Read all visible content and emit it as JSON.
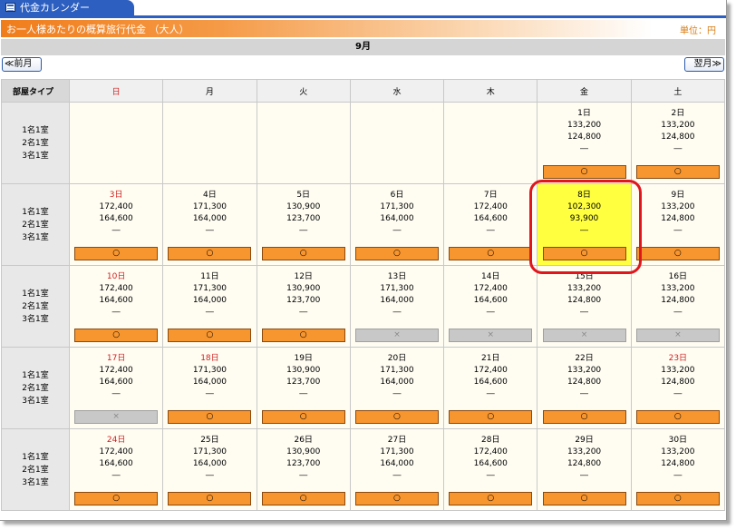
{
  "window": {
    "tab_title": "代金カレンダー"
  },
  "banner": {
    "title": "お一人様あたりの概算旅行代金 （大人）",
    "unit": "単位：円"
  },
  "month": "9月",
  "nav": {
    "prev": "≪前月",
    "next": "翌月≫"
  },
  "header": {
    "room_type": "部屋タイプ",
    "weekdays": [
      "日",
      "月",
      "火",
      "水",
      "木",
      "金",
      "土"
    ]
  },
  "room_types": [
    "1名1室",
    "2名1室",
    "3名1室"
  ],
  "weeks": [
    [
      null,
      null,
      null,
      null,
      null,
      {
        "date": "1日",
        "prices": [
          "133,200",
          "124,800",
          "―"
        ],
        "mark": "○"
      },
      {
        "date": "2日",
        "prices": [
          "133,200",
          "124,800",
          "―"
        ],
        "mark": "○"
      }
    ],
    [
      {
        "date": "3日",
        "prices": [
          "172,400",
          "164,600",
          "―"
        ],
        "mark": "○"
      },
      {
        "date": "4日",
        "prices": [
          "171,300",
          "164,000",
          "―"
        ],
        "mark": "○"
      },
      {
        "date": "5日",
        "prices": [
          "130,900",
          "123,700",
          "―"
        ],
        "mark": "○"
      },
      {
        "date": "6日",
        "prices": [
          "171,300",
          "164,000",
          "―"
        ],
        "mark": "○"
      },
      {
        "date": "7日",
        "prices": [
          "172,400",
          "164,600",
          "―"
        ],
        "mark": "○"
      },
      {
        "date": "8日",
        "prices": [
          "102,300",
          "93,900",
          "―"
        ],
        "mark": "○",
        "highlight": true
      },
      {
        "date": "9日",
        "prices": [
          "133,200",
          "124,800",
          "―"
        ],
        "mark": "○"
      }
    ],
    [
      {
        "date": "10日",
        "prices": [
          "172,400",
          "164,600",
          "―"
        ],
        "mark": "○"
      },
      {
        "date": "11日",
        "prices": [
          "171,300",
          "164,000",
          "―"
        ],
        "mark": "○"
      },
      {
        "date": "12日",
        "prices": [
          "130,900",
          "123,700",
          "―"
        ],
        "mark": "○"
      },
      {
        "date": "13日",
        "prices": [
          "171,300",
          "164,000",
          "―"
        ],
        "mark": "×"
      },
      {
        "date": "14日",
        "prices": [
          "172,400",
          "164,600",
          "―"
        ],
        "mark": "×"
      },
      {
        "date": "15日",
        "prices": [
          "133,200",
          "124,800",
          "―"
        ],
        "mark": "×"
      },
      {
        "date": "16日",
        "prices": [
          "133,200",
          "124,800",
          "―"
        ],
        "mark": "×"
      }
    ],
    [
      {
        "date": "17日",
        "prices": [
          "172,400",
          "164,600",
          "―"
        ],
        "mark": "×"
      },
      {
        "date": "18日",
        "prices": [
          "171,300",
          "164,000",
          "―"
        ],
        "mark": "○",
        "holiday": true
      },
      {
        "date": "19日",
        "prices": [
          "130,900",
          "123,700",
          "―"
        ],
        "mark": "○"
      },
      {
        "date": "20日",
        "prices": [
          "171,300",
          "164,000",
          "―"
        ],
        "mark": "○"
      },
      {
        "date": "21日",
        "prices": [
          "172,400",
          "164,600",
          "―"
        ],
        "mark": "○"
      },
      {
        "date": "22日",
        "prices": [
          "133,200",
          "124,800",
          "―"
        ],
        "mark": "○"
      },
      {
        "date": "23日",
        "prices": [
          "133,200",
          "124,800",
          "―"
        ],
        "mark": "○",
        "holiday": true
      }
    ],
    [
      {
        "date": "24日",
        "prices": [
          "172,400",
          "164,600",
          "―"
        ],
        "mark": "○"
      },
      {
        "date": "25日",
        "prices": [
          "171,300",
          "164,000",
          "―"
        ],
        "mark": "○"
      },
      {
        "date": "26日",
        "prices": [
          "130,900",
          "123,700",
          "―"
        ],
        "mark": "○"
      },
      {
        "date": "27日",
        "prices": [
          "171,300",
          "164,000",
          "―"
        ],
        "mark": "○"
      },
      {
        "date": "28日",
        "prices": [
          "172,400",
          "164,600",
          "―"
        ],
        "mark": "○"
      },
      {
        "date": "29日",
        "prices": [
          "133,200",
          "124,800",
          "―"
        ],
        "mark": "○"
      },
      {
        "date": "30日",
        "prices": [
          "133,200",
          "124,800",
          "―"
        ],
        "mark": "○"
      }
    ]
  ],
  "colors": {
    "accent": "#2d5fc0",
    "orange": "#f7952e",
    "highlight": "#ffff40",
    "ring": "#e0161d",
    "sunday": "#d02020"
  }
}
